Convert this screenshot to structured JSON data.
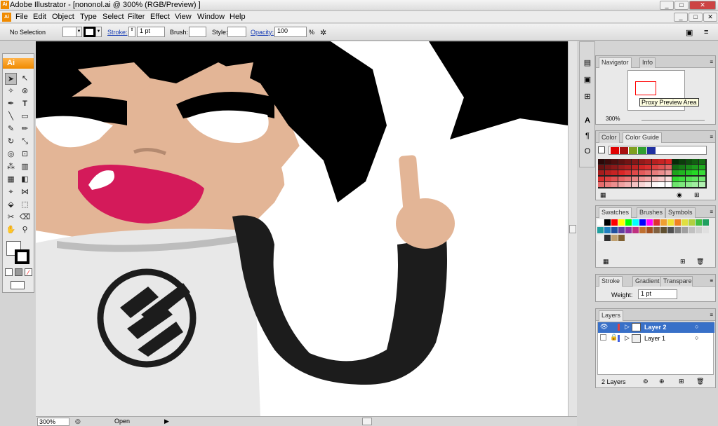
{
  "window": {
    "title": "Adobe Illustrator - [nononol.ai @ 300% (RGB/Preview) ]",
    "app_icon": "Ai",
    "controls": [
      "_",
      "□",
      "✕"
    ],
    "doc_controls": [
      "_",
      "□",
      "✕"
    ]
  },
  "menu": [
    "File",
    "Edit",
    "Object",
    "Type",
    "Select",
    "Filter",
    "Effect",
    "View",
    "Window",
    "Help"
  ],
  "control": {
    "selection": "No Selection",
    "stroke_label": "Stroke:",
    "stroke_value": "1 pt",
    "brush_label": "Brush:",
    "style_label": "Style:",
    "opacity_label": "Opacity:",
    "opacity_value": "100",
    "opacity_unit": "%"
  },
  "toolbox": {
    "header": "Ai"
  },
  "status": {
    "zoom": "300%",
    "state": "Open"
  },
  "navigator": {
    "tabs": [
      "Navigator",
      "Info"
    ],
    "zoom": "300%",
    "tooltip": "Proxy Preview Area"
  },
  "color": {
    "tabs": [
      "Color",
      "Color Guide"
    ],
    "harmony": [
      "#e00000",
      "#a81010",
      "#80a020",
      "#30a030",
      "#2030a0"
    ]
  },
  "swatches": {
    "tabs": [
      "Swatches",
      "Brushes",
      "Symbols"
    ],
    "colors": [
      "#ffffff",
      "#000000",
      "#ff0000",
      "#ffff00",
      "#00ff00",
      "#00ffff",
      "#0000ff",
      "#ff00ff",
      "#e03030",
      "#f0a030",
      "#f0e030",
      "#f08020",
      "#e0e040",
      "#b0d040",
      "#40c040",
      "#20a060",
      "#20a0a0",
      "#2080c0",
      "#2050a0",
      "#6040a0",
      "#9030a0",
      "#c03080",
      "#c07030",
      "#a05020",
      "#806040",
      "#605030",
      "#505050",
      "#808080",
      "#a0a0a0",
      "#c0c0c0",
      "#d0d0d0",
      "#e0e0e0",
      "#f0f0f0",
      "#303030",
      "#c0a070",
      "#806030"
    ]
  },
  "stroke": {
    "tabs": [
      "Stroke",
      "Gradient",
      "Transparency"
    ],
    "weight_label": "Weight:",
    "weight_value": "1 pt"
  },
  "layers": {
    "tabs": [
      "Layers"
    ],
    "items": [
      "Layer 2",
      "Layer 1"
    ],
    "count": "2 Layers"
  }
}
